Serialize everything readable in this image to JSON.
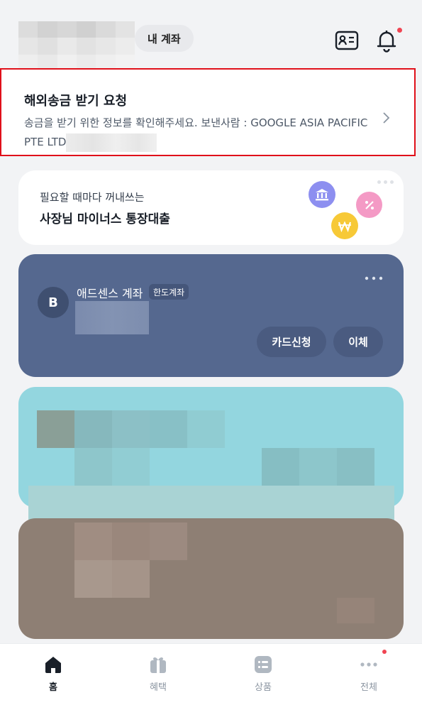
{
  "header": {
    "my_account_label": "내 계좌",
    "icons": [
      "id-card-icon",
      "bell-icon"
    ],
    "has_notification": true
  },
  "notice": {
    "title": "해외송금 받기 요청",
    "body": "송금을 받기 위한 정보를 확인해주세요. 보낸사람 : GOOGLE ASIA PACIFIC PTE LTD",
    "icon": "chevron-right-icon"
  },
  "promo": {
    "subtitle": "필요할 때마다 꺼내쓰는",
    "title": "사장님 마이너스 통장대출",
    "icons": [
      "bank-coin-icon",
      "percent-coin-icon",
      "won-coin-icon"
    ]
  },
  "account_card": {
    "avatar_letter": "B",
    "name": "애드센스 계좌",
    "badge": "한도계좌",
    "buttons": {
      "card_apply": "카드신청",
      "transfer": "이체"
    },
    "color": "#55688f"
  },
  "bottom_nav": {
    "items": [
      {
        "label": "홈",
        "icon": "home-icon",
        "active": true
      },
      {
        "label": "혜택",
        "icon": "gift-icon",
        "active": false
      },
      {
        "label": "상품",
        "icon": "list-icon",
        "active": false
      },
      {
        "label": "전체",
        "icon": "more-dots-icon",
        "active": false
      }
    ]
  },
  "colors": {
    "background": "#f2f3f5",
    "highlight_border": "#e0101a",
    "notification_dot": "#f04452"
  }
}
